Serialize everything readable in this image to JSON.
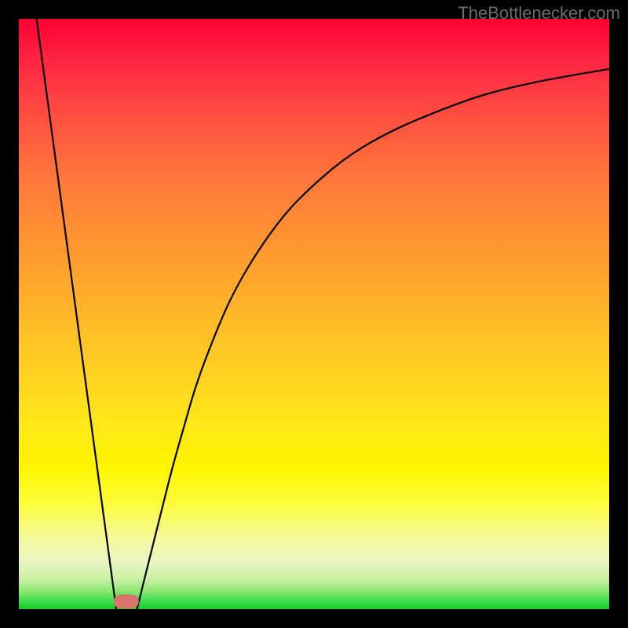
{
  "watermark": "TheBottlenecker.com",
  "chart_data": {
    "type": "line",
    "title": "",
    "xlabel": "",
    "ylabel": "",
    "xlim": [
      0,
      100
    ],
    "ylim": [
      0,
      100
    ],
    "series": [
      {
        "name": "left-line",
        "x": [
          3,
          16.5
        ],
        "y": [
          100,
          0
        ]
      },
      {
        "name": "right-curve",
        "x": [
          20,
          22,
          24,
          26,
          28,
          30,
          33,
          36,
          40,
          45,
          50,
          56,
          63,
          70,
          78,
          86,
          94,
          100
        ],
        "y": [
          0,
          8,
          16,
          24,
          31,
          38,
          46,
          53,
          60,
          67,
          72,
          77,
          81,
          84,
          87,
          89,
          90.5,
          91.5
        ]
      }
    ],
    "marker": {
      "name": "min-point",
      "x_percent": 18.2,
      "y_percent": 0.5,
      "color": "#d9736b"
    },
    "background_gradient": "red-to-green"
  }
}
